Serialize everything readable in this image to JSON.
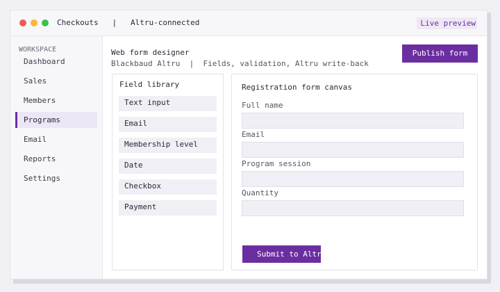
{
  "window": {
    "app_name": "Checkouts",
    "separator": "|",
    "subtitle": "Altru-connected",
    "preview_badge": "Live preview"
  },
  "sidebar": {
    "section_label": "WORKSPACE",
    "items": [
      {
        "label": "Dashboard"
      },
      {
        "label": "Sales"
      },
      {
        "label": "Members"
      },
      {
        "label": "Programs",
        "active": true
      },
      {
        "label": "Email"
      },
      {
        "label": "Reports"
      },
      {
        "label": "Settings"
      }
    ]
  },
  "header": {
    "title": "Web form designer",
    "subtitle": "Blackbaud Altru  |  Fields, validation, Altru write-back",
    "publish_label": "Publish form"
  },
  "library": {
    "title": "Field library",
    "items": [
      {
        "label": "Text input"
      },
      {
        "label": "Email"
      },
      {
        "label": "Membership level"
      },
      {
        "label": "Date"
      },
      {
        "label": "Checkbox"
      },
      {
        "label": "Payment"
      }
    ]
  },
  "canvas": {
    "title": "Registration form canvas",
    "fields": [
      {
        "label": "Full name",
        "value": ""
      },
      {
        "label": "Email",
        "value": ""
      },
      {
        "label": "Program session",
        "value": ""
      },
      {
        "label": "Quantity",
        "value": ""
      }
    ],
    "submit_label": "Submit to Altru"
  },
  "colors": {
    "accent": "#6b2ea0",
    "active_nav_bg": "#ece6f6",
    "badge_bg": "#efe7f6"
  }
}
